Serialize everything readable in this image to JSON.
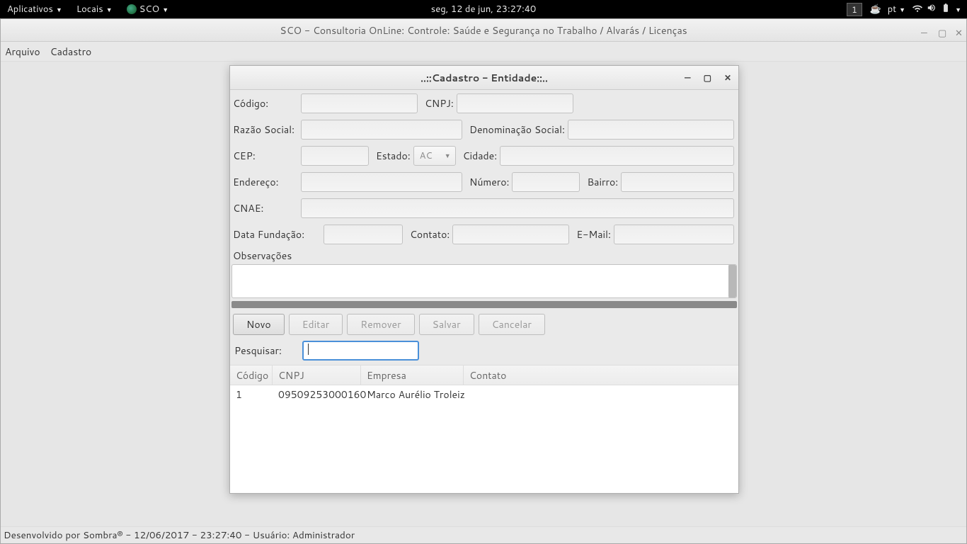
{
  "topbar": {
    "apps": "Aplicativos",
    "places": "Locais",
    "app_name": "SCO",
    "clock": "seg, 12 de jun, 23:27:40",
    "workspace": "1",
    "lang": "pt"
  },
  "window": {
    "title": "SCO - Consultoria OnLine: Controle: Saúde e Segurança no Trabalho / Alvarás / Licenças",
    "menu_file": "Arquivo",
    "menu_cadastro": "Cadastro"
  },
  "dialog": {
    "title": "..::Cadastro - Entidade::..",
    "labels": {
      "codigo": "Código:",
      "cnpj": "CNPJ:",
      "razao": "Razão Social:",
      "denom": "Denominação Social:",
      "cep": "CEP:",
      "estado": "Estado:",
      "estado_value": "AC",
      "cidade": "Cidade:",
      "endereco": "Endereço:",
      "numero": "Número:",
      "bairro": "Bairro:",
      "cnae": "CNAE:",
      "fundacao": "Data Fundação:",
      "contato": "Contato:",
      "email": "E-Mail:",
      "obs": "Observações",
      "pesquisar": "Pesquisar:"
    },
    "buttons": {
      "novo": "Novo",
      "editar": "Editar",
      "remover": "Remover",
      "salvar": "Salvar",
      "cancelar": "Cancelar"
    },
    "table": {
      "headers": {
        "codigo": "Código",
        "cnpj": "CNPJ",
        "empresa": "Empresa",
        "contato": "Contato"
      },
      "rows": [
        {
          "codigo": "1",
          "cnpj": "09509253000160",
          "empresa": "Marco Aurélio Troleiz",
          "contato": ""
        }
      ]
    }
  },
  "statusbar": "Desenvolvido por Sombra® - 12/06/2017 - 23:27:40 - Usuário: Administrador"
}
